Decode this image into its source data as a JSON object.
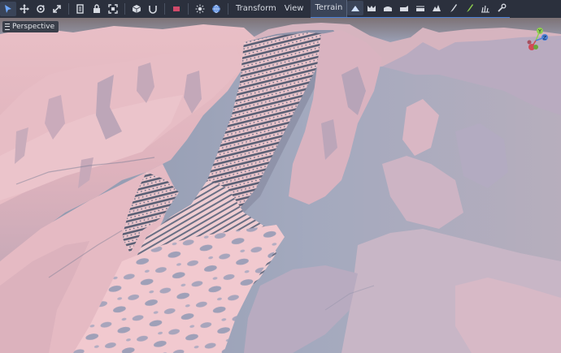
{
  "toolbar": {
    "tools": [
      {
        "name": "select-icon"
      },
      {
        "name": "move-icon"
      },
      {
        "name": "rotate-icon"
      },
      {
        "name": "scale-icon"
      },
      {
        "name": "list-icon"
      },
      {
        "name": "lock-icon"
      },
      {
        "name": "group-icon"
      },
      {
        "name": "cube-icon"
      },
      {
        "name": "snap-icon"
      },
      {
        "name": "tag-icon"
      },
      {
        "name": "sun-icon"
      },
      {
        "name": "globe-icon"
      }
    ],
    "menus": {
      "transform": "Transform",
      "view": "View",
      "terrain": "Terrain"
    },
    "terrain_tools": [
      {
        "name": "raise-icon"
      },
      {
        "name": "lower-icon"
      },
      {
        "name": "smooth-icon"
      },
      {
        "name": "flatten-icon"
      },
      {
        "name": "ramp-icon"
      },
      {
        "name": "erode-icon"
      },
      {
        "name": "paint-icon"
      },
      {
        "name": "color-icon"
      },
      {
        "name": "grass-icon"
      },
      {
        "name": "settings-icon"
      }
    ]
  },
  "viewport": {
    "perspective_label": "Perspective",
    "gizmo": {
      "y": "Y",
      "z": "Z"
    },
    "colors": {
      "sky": "#8e97ad",
      "terrain": "#ecc1c8",
      "shadow": "#9aa3bc",
      "accent": "#4b80d6"
    }
  }
}
